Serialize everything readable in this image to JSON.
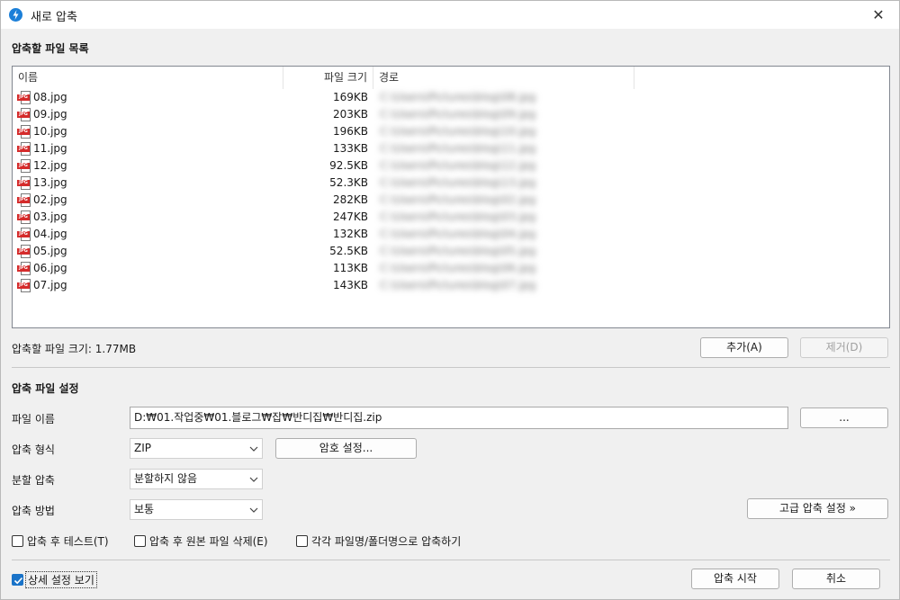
{
  "window": {
    "title": "새로 압축",
    "close_glyph": "✕"
  },
  "file_list": {
    "section_title": "압축할 파일 목록",
    "columns": {
      "name": "이름",
      "size": "파일 크기",
      "path": "경로"
    },
    "rows": [
      {
        "name": "08.jpg",
        "size": "169KB",
        "path": "C:\\Users\\Pictures\\blog\\08.jpg"
      },
      {
        "name": "09.jpg",
        "size": "203KB",
        "path": "C:\\Users\\Pictures\\blog\\09.jpg"
      },
      {
        "name": "10.jpg",
        "size": "196KB",
        "path": "C:\\Users\\Pictures\\blog\\10.jpg"
      },
      {
        "name": "11.jpg",
        "size": "133KB",
        "path": "C:\\Users\\Pictures\\blog\\11.jpg"
      },
      {
        "name": "12.jpg",
        "size": "92.5KB",
        "path": "C:\\Users\\Pictures\\blog\\12.jpg"
      },
      {
        "name": "13.jpg",
        "size": "52.3KB",
        "path": "C:\\Users\\Pictures\\blog\\13.jpg"
      },
      {
        "name": "02.jpg",
        "size": "282KB",
        "path": "C:\\Users\\Pictures\\blog\\02.jpg"
      },
      {
        "name": "03.jpg",
        "size": "247KB",
        "path": "C:\\Users\\Pictures\\blog\\03.jpg"
      },
      {
        "name": "04.jpg",
        "size": "132KB",
        "path": "C:\\Users\\Pictures\\blog\\04.jpg"
      },
      {
        "name": "05.jpg",
        "size": "52.5KB",
        "path": "C:\\Users\\Pictures\\blog\\05.jpg"
      },
      {
        "name": "06.jpg",
        "size": "113KB",
        "path": "C:\\Users\\Pictures\\blog\\06.jpg"
      },
      {
        "name": "07.jpg",
        "size": "143KB",
        "path": "C:\\Users\\Pictures\\blog\\07.jpg"
      }
    ],
    "file_type_tag": "JPG",
    "total_size": "압축할 파일 크기: 1.77MB",
    "add_button": "추가(A)",
    "remove_button": "제거(D)"
  },
  "settings": {
    "section_title": "압축 파일 설정",
    "filename_label": "파일 이름",
    "filename_value": "D:₩01.작업중₩01.블로그₩잡₩반디집₩반디집.zip",
    "browse_button": "...",
    "format_label": "압축 형식",
    "format_value": "ZIP",
    "password_button": "암호 설정...",
    "split_label": "분할 압축",
    "split_value": "분할하지 않음",
    "method_label": "압축 방법",
    "method_value": "보통",
    "advanced_button": "고급 압축 설정 »",
    "test_after": "압축 후 테스트(T)",
    "delete_original": "압축 후 원본 파일 삭제(E)",
    "each_to_folder": "각각 파일명/폴더명으로 압축하기"
  },
  "footer": {
    "show_details": "상세 설정 보기",
    "start_button": "압축 시작",
    "cancel_button": "취소"
  },
  "colors": {
    "accent": "#1a73c8",
    "tag_red": "#d52b2b"
  }
}
